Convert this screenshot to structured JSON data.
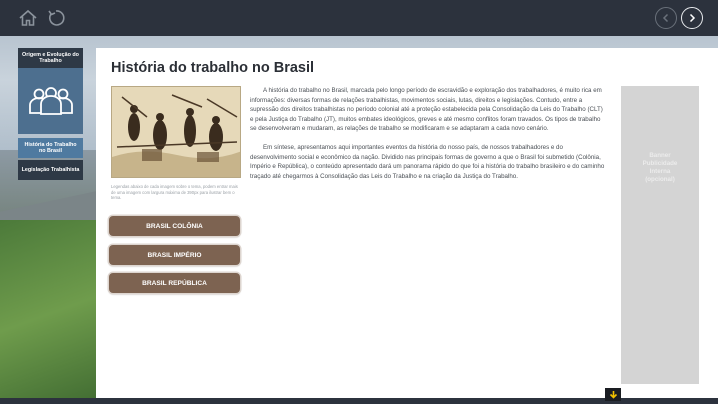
{
  "nav": {
    "home_icon": "home-icon",
    "reload_icon": "reload-icon",
    "prev_icon": "chevron-left-icon",
    "next_icon": "chevron-right-icon",
    "down_icon": "arrow-down-icon"
  },
  "sidebar": {
    "header": "Origem e Evolução do Trabalho",
    "image_icon": "people-group-icon",
    "items": [
      {
        "label": "História do Trabalho no Brasil",
        "active": true
      },
      {
        "label": "Legislação Trabalhista",
        "active": false
      }
    ]
  },
  "main": {
    "title": "História do trabalho no Brasil",
    "caption": "Legendas abaixo de cada imagem sobre o tema, podem entrar mais de uma imagem com largura máxima de 390px para ilustrar bem o tema.",
    "buttons": {
      "colonia": "BRASIL COLÔNIA",
      "imperio": "BRASIL IMPÉRIO",
      "republica": "BRASIL REPÚBLICA"
    },
    "paragraphs": [
      "A história do trabalho no Brasil, marcada pelo longo período de escravidão e exploração dos trabalhadores, é muito rica em informações: diversas formas de relações trabalhistas, movimentos sociais, lutas, direitos e legislações. Contudo, entre a supressão dos direitos trabalhistas no período colonial até a proteção estabelecida pela Consolidação da Leis do Trabalho (CLT) e pela Justiça do Trabalho (JT), muitos embates ideológicos, greves e até mesmo conflitos foram travados. Os tipos de trabalho se desenvolveram e mudaram, as relações de trabalho se modificaram e se adaptaram a cada novo cenário.",
      "Em síntese, apresentamos aqui importantes eventos da história do nosso país, de nossos trabalhadores e do desenvolvimento social e econômico da nação. Dividido nas principais formas de governo a que o Brasil foi submetido (Colônia, Império e República), o conteúdo apresentado dará um panorama rápido do que foi a história do trabalho brasileiro e do caminho traçado até chegarmos à Consolidação das Leis do Trabalho e na criação da Justiça do Trabalho."
    ],
    "banner": "Banner Publicidade Interna (opcional)"
  },
  "colors": {
    "topbar": "#2c323d",
    "sidebar_dark": "#2e3946",
    "sidebar_active": "#4f7aa0",
    "button_brown": "#7d6351",
    "banner_gray": "#d4d4d4"
  }
}
